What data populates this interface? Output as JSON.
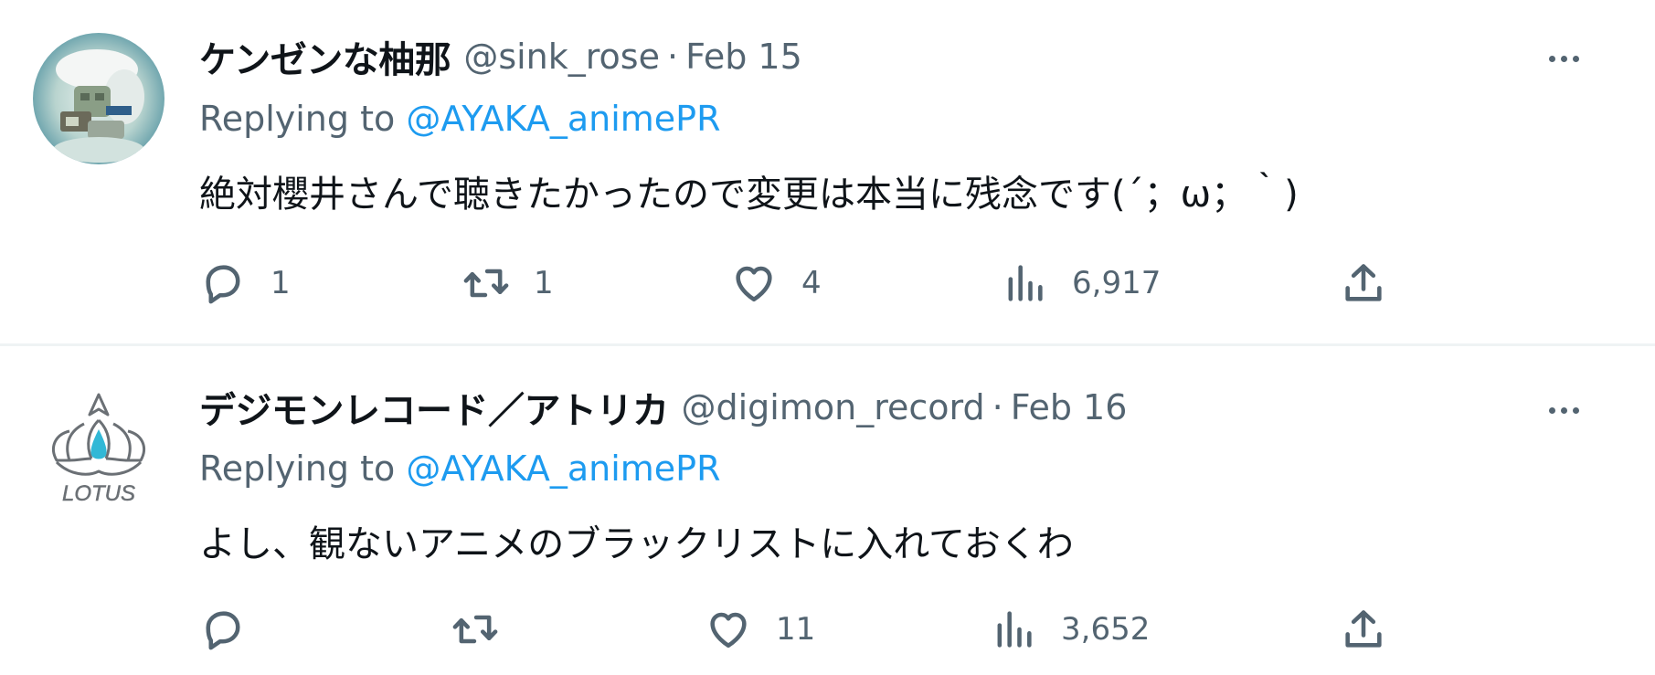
{
  "tweets": [
    {
      "display_name": "ケンゼンな柚那",
      "handle": "@sink_rose",
      "separator": "·",
      "date": "Feb 15",
      "replying_prefix": "Replying to ",
      "replying_to": "@AYAKA_animePR",
      "text": "絶対櫻井さんで聴きたかったので変更は本当に残念です(´；ω；｀)",
      "stats": {
        "replies": "1",
        "retweets": "1",
        "likes": "4",
        "views": "6,917"
      }
    },
    {
      "display_name": "デジモンレコード／アトリカ",
      "handle": "@digimon_record",
      "separator": "·",
      "date": "Feb 16",
      "replying_prefix": "Replying to ",
      "replying_to": "@AYAKA_animePR",
      "text": "よし、観ないアニメのブラックリストに入れておくわ",
      "stats": {
        "replies": "",
        "retweets": "",
        "likes": "11",
        "views": "3,652"
      },
      "avatar_logo_text": "LOTUS"
    }
  ],
  "icons": {
    "reply": "speech-bubble-icon",
    "retweet": "retweet-arrows-icon",
    "like": "heart-icon",
    "views": "bar-chart-icon",
    "share": "share-upload-icon",
    "more": "more-dots-icon"
  },
  "colors": {
    "text_primary": "#0f1419",
    "text_secondary": "#536471",
    "link": "#1d9bf0",
    "divider": "#eff3f4"
  }
}
